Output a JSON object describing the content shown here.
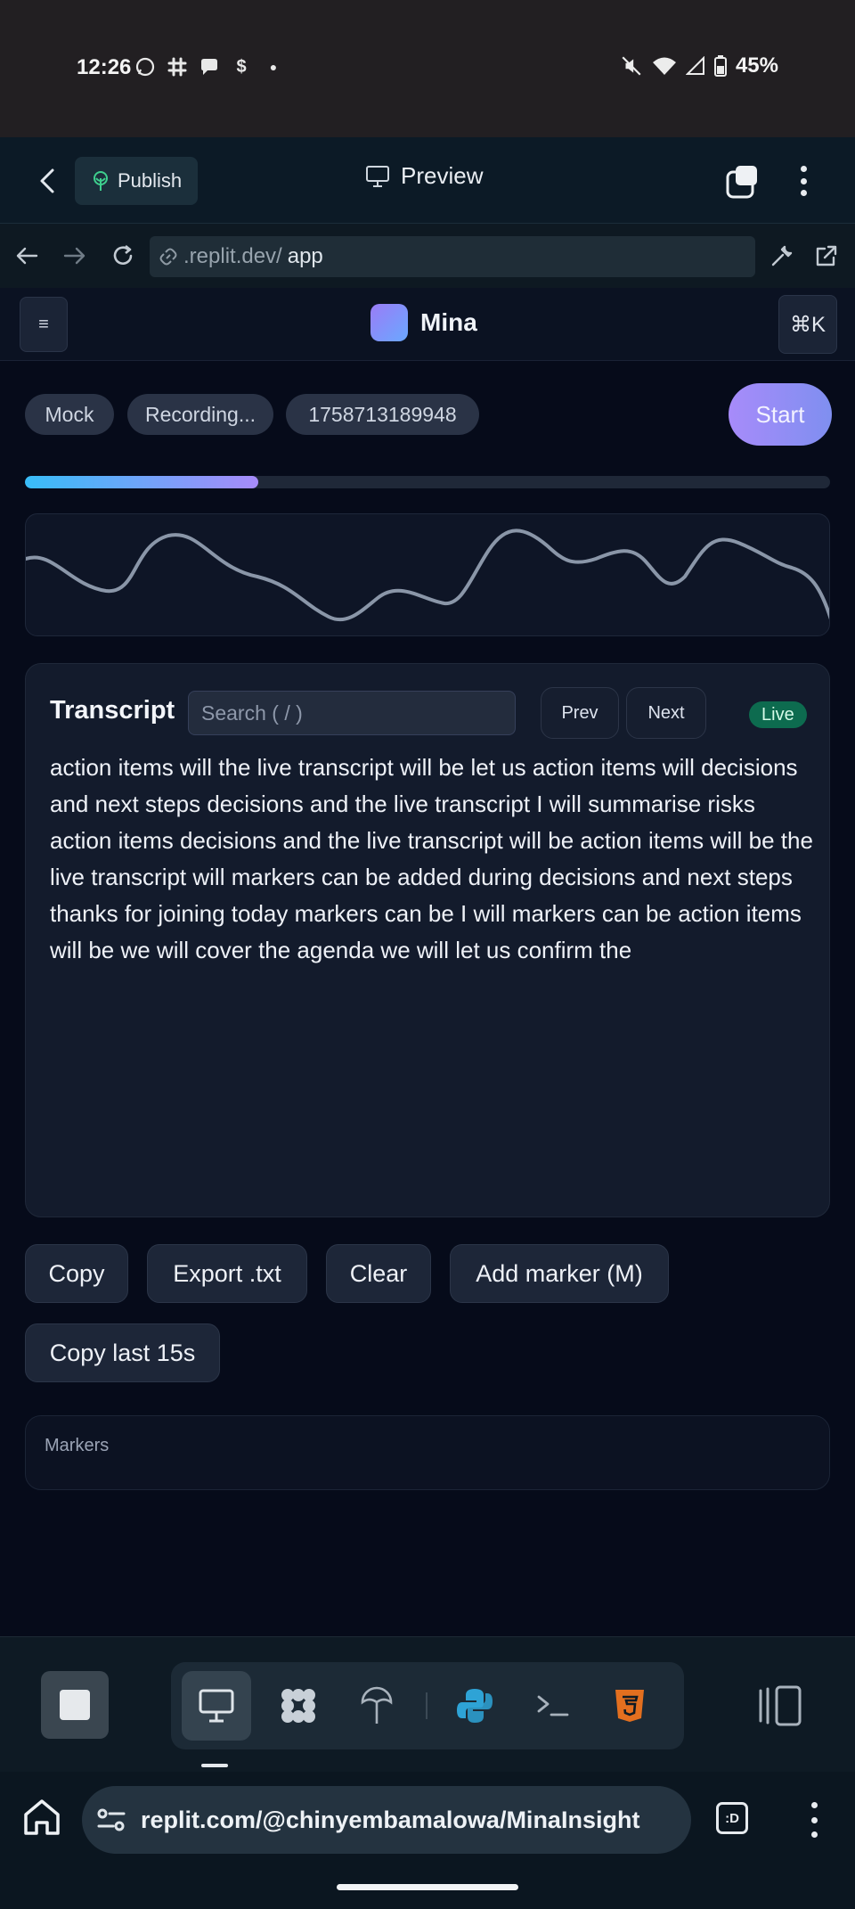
{
  "status_bar": {
    "time": "12:26",
    "battery": "45%",
    "notification_icons": [
      "whatsapp-icon",
      "slack-icon",
      "chat-icon",
      "dollar-icon",
      "dot-icon"
    ]
  },
  "replit_header": {
    "publish_label": "Publish",
    "preview_label": "Preview"
  },
  "browser": {
    "url_prefix": ".replit.dev/",
    "url_path": "app"
  },
  "app_header": {
    "menu_glyph": "≡",
    "app_name": "Mina",
    "cmdk_label": "⌘K"
  },
  "status_pills": {
    "mode": "Mock",
    "state": "Recording...",
    "session_id": "1758713189948"
  },
  "start_button": {
    "label": "Start"
  },
  "recording_progress": {
    "fraction": 0.29
  },
  "transcript": {
    "title": "Transcript",
    "search_placeholder": "Search ( / )",
    "prev_label": "Prev",
    "next_label": "Next",
    "live_label": "Live",
    "text": "action items will the live transcript will be let us action items will decisions and next steps decisions and the live transcript I will summarise risks action items decisions and the live transcript will be action items will be the live transcript will markers can be added during decisions and next steps thanks for joining today markers can be I will markers can be action items will be we will cover the agenda we will let us confirm the"
  },
  "actions": {
    "copy": "Copy",
    "export": "Export .txt",
    "clear": "Clear",
    "add_marker": "Add marker (M)",
    "copy_last": "Copy last 15s"
  },
  "markers": {
    "label": "Markers"
  },
  "chrome": {
    "url": "replit.com/@chinyembamalowa/MinaInsight",
    "tab_badge": ":D"
  },
  "colors": {
    "accent_start": "#a78bfa",
    "live_badge": "#0d6b4f",
    "progress_from": "#38bdf8",
    "progress_to": "#a78bfa"
  }
}
